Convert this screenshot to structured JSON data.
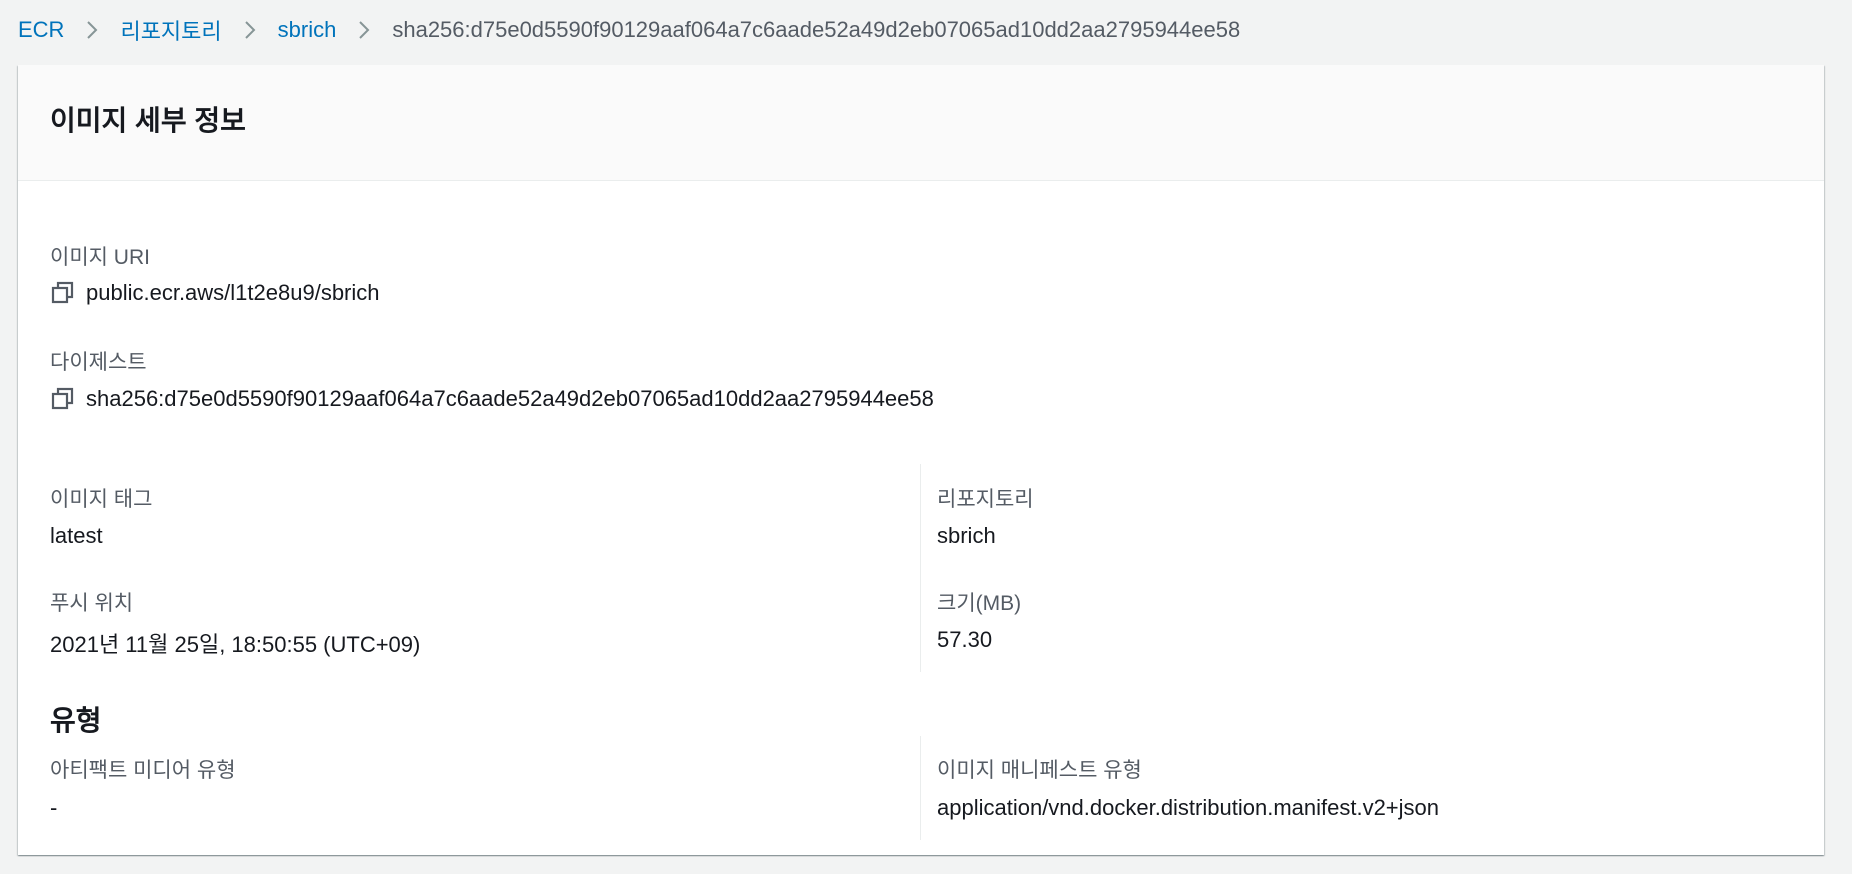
{
  "breadcrumb": {
    "items": [
      "ECR",
      "리포지토리",
      "sbrich"
    ],
    "current": "sha256:d75e0d5590f90129aaf064a7c6aade52a49d2eb07065ad10dd2aa2795944ee58"
  },
  "panel": {
    "title": "이미지 세부 정보"
  },
  "details": {
    "image_uri_label": "이미지 URI",
    "image_uri": "public.ecr.aws/l1t2e8u9/sbrich",
    "digest_label": "다이제스트",
    "digest": "sha256:d75e0d5590f90129aaf064a7c6aade52a49d2eb07065ad10dd2aa2795944ee58",
    "image_tag_label": "이미지 태그",
    "image_tag": "latest",
    "repository_label": "리포지토리",
    "repository": "sbrich",
    "pushed_at_label": "푸시 위치",
    "pushed_at": "2021년 11월 25일, 18:50:55 (UTC+09)",
    "size_label": "크기(MB)",
    "size": "57.30"
  },
  "type_section": {
    "title": "유형",
    "artifact_media_type_label": "아티팩트 미디어 유형",
    "artifact_media_type": "-",
    "manifest_type_label": "이미지 매니페스트 유형",
    "manifest_type": "application/vnd.docker.distribution.manifest.v2+json"
  },
  "colors": {
    "link": "#0073bb",
    "text": "#16191f",
    "label": "#545b64",
    "background": "#f2f3f3"
  },
  "icons": [
    "chevron-right-icon",
    "copy-icon"
  ]
}
